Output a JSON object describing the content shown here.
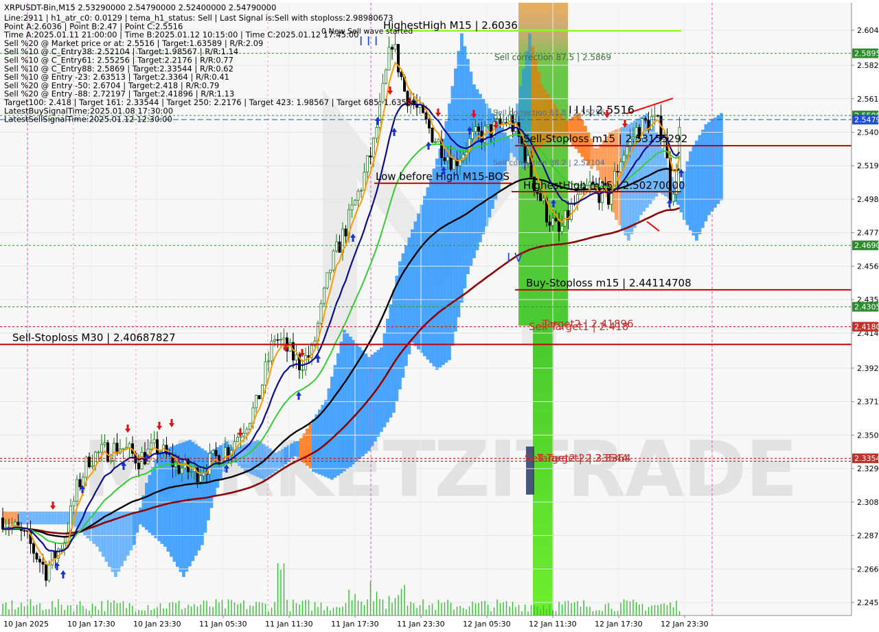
{
  "chart_data": {
    "type": "candlestick",
    "symbol_line": "XRPUSDT-Bin,M15  2.53290000 2.54790000 2.52400000 2.54790000",
    "info_lines": [
      "Line:2911 | h1_atr_c0: 0.0129 | tema_h1_status: Sell | Last Signal is:Sell with stoploss:2.98980673",
      "Point A:2.6036 | Point B:2.47 | Point C:2.5516",
      "Time A:2025.01.11 21:00:00 | Time B:2025.01.12 10:15:00 | Time C:2025.01.12 17:45:00",
      "Sell %20 @ Market price or at: 2.5516 | Target:1.63589 | R/R:2.09",
      "Sell %10 @ C_Entry38: 2.52104 | Target:1.98567 | R/R:1.14",
      "Sell %10 @ C_Entry61: 2.55256 | Target:2.2176 | R/R:0.77",
      "Sell %10 @ C_Entry88: 2.5869 | Target:2.33544 | R/R:0.62",
      "Sell %10 @ Entry -23: 2.63513 | Target:2.3364 | R/R:0.41",
      "Sell %20 @ Entry -50: 2.6704 | Target:2.418 | R/R:0.79",
      "Sell %20 @ Entry -88: 2.72197 | Target:2.41896 | R/R:1.13",
      "Target100: 2.418 | Target 161: 2.33544 | Target 250: 2.2176 | Target 423: 1.98567 | Target 685: 1.63589",
      "LatestBuySignalTime:2025.01.08 17:30:00",
      "LatestSellSignalTime:2025.01.12 12:30:00"
    ],
    "y_ticks": [
      "2.604",
      "2.582",
      "2.561",
      "2.540",
      "2.519",
      "2.498",
      "2.477",
      "2.456",
      "2.435",
      "2.414",
      "2.392",
      "2.371",
      "2.350",
      "2.329",
      "2.308",
      "2.287",
      "2.266",
      "2.245"
    ],
    "ylim": [
      2.239,
      2.617
    ],
    "x_ticks": [
      "10 Jan 2025",
      "10 Jan 17:30",
      "10 Jan 23:30",
      "11 Jan 05:30",
      "11 Jan 11:30",
      "11 Jan 17:30",
      "11 Jan 23:30",
      "12 Jan 05:30",
      "12 Jan 11:30",
      "12 Jan 17:30",
      "12 Jan 23:30"
    ],
    "price_badges": [
      {
        "label": "2.5895",
        "value": 2.5895,
        "color": "#2e8b2e"
      },
      {
        "label": "2.5505",
        "value": 2.5505,
        "color": "#2e8b2e"
      },
      {
        "label": "2.5479",
        "value": 2.5479,
        "color": "#1f4fd8"
      },
      {
        "label": "2.4690",
        "value": 2.469,
        "color": "#2e8b2e"
      },
      {
        "label": "2.4305",
        "value": 2.4305,
        "color": "#2e8b2e"
      },
      {
        "label": "2.4180",
        "value": 2.418,
        "color": "#c0312b"
      },
      {
        "label": "2.3354",
        "value": 2.3354,
        "color": "#c0312b"
      }
    ],
    "level_labels": {
      "highest_high": "HighestHigh   M15 | 2.6036",
      "new_sell_wave": "0 New Sell wave started",
      "sell_correction_875": "Sell correction 87.5 | 2.5869",
      "sell_correction_618": "Sell correction 61.8 | 2.55256",
      "sell_correction_382": "Sell correction 38.2 | 2.52104",
      "point_c": "I I I | 2.5516",
      "sell_stoploss_m15": "Sell-Stoploss m15 | 2.53155292",
      "low_before_high": "Low before High   M15-BOS",
      "highest_high_m15": "HighestHigh m15 | 2.50270000",
      "buy_stoploss_m15": "Buy-Stoploss m15 | 2.44114708",
      "sell_stoploss_m30": "Sell-Stoploss M30 | 2.40687827",
      "sell_target1": "Sell Target1 | 2.418",
      "target1_overlap": "Target2 | 2.41896",
      "sell_target2": "Sell Target2 | 2.3364",
      "target2_overlap": "Target2 | 2.33544",
      "wave_iii": "I I I",
      "wave_iv": "I V"
    },
    "watermark": "MARKETZITRADE",
    "colors": {
      "up_candle": "#1a7a1a",
      "down_candle": "#000000",
      "cloud_blue": "#1e90ff",
      "cloud_orange": "#ff6a00",
      "ema_navy": "#0a0a8c",
      "ema_green": "#32cd32",
      "ema_orange": "#ff9900",
      "ma_black": "#000000",
      "ma_maroon": "#8b0000",
      "target_red": "#c00000",
      "green_level": "#2e8b2e"
    }
  }
}
